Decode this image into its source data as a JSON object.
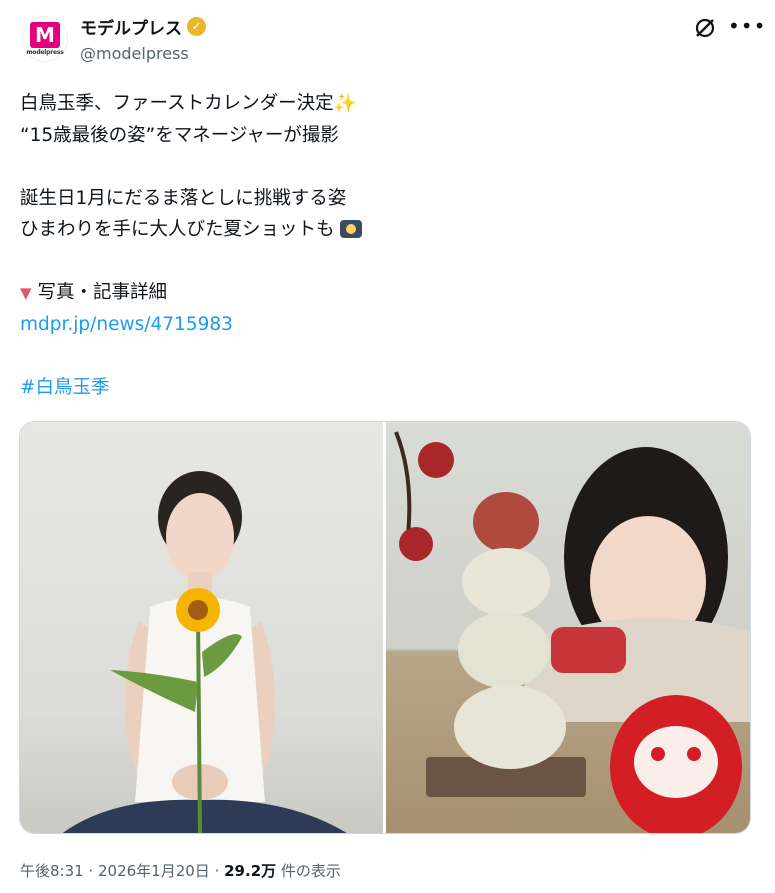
{
  "account": {
    "display_name": "モデルプレス",
    "handle": "@modelpress",
    "avatar_letter": "M",
    "avatar_caption": "modelpress",
    "verified_icon": "verified-gold-badge",
    "brand_color": "#e2007f"
  },
  "actions": {
    "grok_icon": "grok-icon",
    "more_icon": "more-icon"
  },
  "post": {
    "line1": "白鳥玉季、ファーストカレンダー決定",
    "line1_emoji": "✨",
    "line2": "“15歳最後の姿”をマネージャーが撮影",
    "line3": "誕生日1月にだるま落としに挑戦する姿",
    "line4": "ひまわりを手に大人びた夏ショットも",
    "line4_emoji_icon": "camera-flash-icon",
    "line5_marker": "▼",
    "line5": "写真・記事詳細",
    "link": "mdpr.jp/news/4715983",
    "hashtag": "#白鳥玉季"
  },
  "media": {
    "photos": [
      {
        "name": "photo-sunflower"
      },
      {
        "name": "photo-daruma-otoshi"
      }
    ]
  },
  "footer": {
    "time": "午後8:31",
    "sep1": " · ",
    "date": "2026年1月20日",
    "sep2": " · ",
    "views": "29.2万",
    "views_suffix": " 件の表示"
  },
  "colors": {
    "link": "#1d9bf0",
    "secondary_text": "#536471",
    "verified": "#e8b829"
  }
}
